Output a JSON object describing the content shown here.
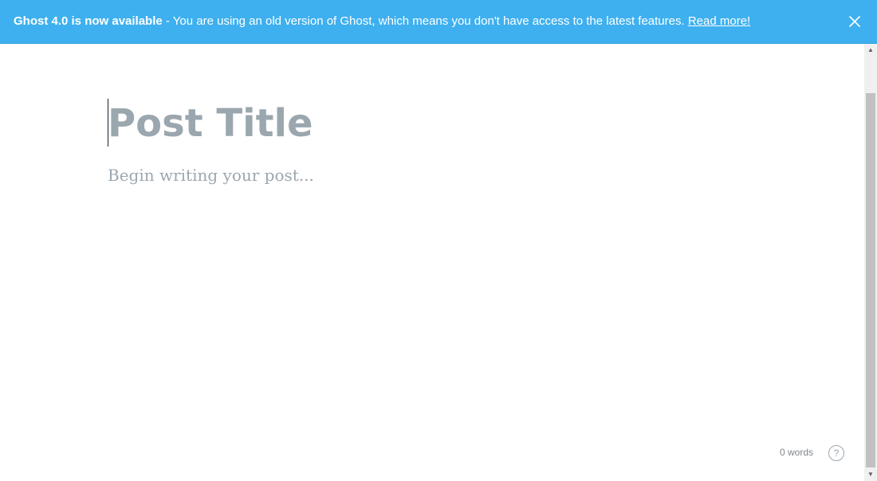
{
  "banner": {
    "strong_text": "Ghost 4.0 is now available",
    "message": " - You are using an old version of Ghost, which means you don't have access to the latest features. ",
    "link_label": "Read more!",
    "close_icon": "close-icon",
    "background_color": "#3eb0ef"
  },
  "editor": {
    "title_placeholder": "Post Title",
    "title_value": "",
    "body_placeholder": "Begin writing your post...",
    "body_value": ""
  },
  "footer": {
    "word_count": "0 words",
    "help_label": "?",
    "help_icon": "help-circle-icon"
  },
  "scrollbar": {
    "up_arrow": "▲",
    "down_arrow": "▼"
  }
}
